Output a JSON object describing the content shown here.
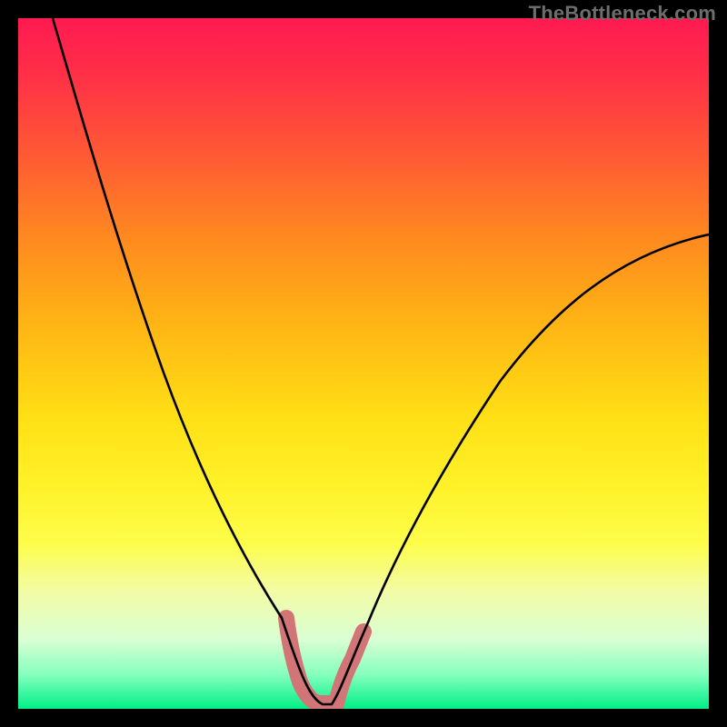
{
  "watermark": "TheBottleneck.com",
  "chart_data": {
    "type": "line",
    "title": "",
    "xlabel": "",
    "ylabel": "",
    "xlim": [
      0,
      100
    ],
    "ylim": [
      0,
      100
    ],
    "grid": false,
    "note": "Unlabeled V-shaped bottleneck curve over a red-to-green vertical gradient. Optimal point sits near x≈42 where the curve touches the bottom (green).",
    "series": [
      {
        "name": "bottleneck-curve",
        "x": [
          4,
          7,
          10,
          13,
          16,
          19,
          22,
          25,
          28,
          31,
          34,
          37,
          39,
          40,
          41,
          42,
          43,
          44,
          45,
          46,
          48,
          51,
          55,
          60,
          65,
          70,
          75,
          80,
          85,
          90,
          95,
          100
        ],
        "values": [
          100,
          93,
          86,
          79,
          72,
          65,
          58,
          51,
          44,
          37,
          29,
          21,
          15,
          10,
          5,
          2,
          0,
          0,
          1,
          3,
          7,
          13,
          21,
          30,
          38,
          45,
          51,
          56,
          60,
          63,
          66,
          68
        ]
      }
    ],
    "minimum_highlight": {
      "name": "optimal-zone",
      "x_start": 39,
      "x_end": 48,
      "color": "#d27576"
    },
    "gradient_stops": [
      {
        "pos": 0,
        "color": "#ff1a51"
      },
      {
        "pos": 50,
        "color": "#ffd020"
      },
      {
        "pos": 80,
        "color": "#fff96a"
      },
      {
        "pos": 100,
        "color": "#00ef86"
      }
    ]
  }
}
